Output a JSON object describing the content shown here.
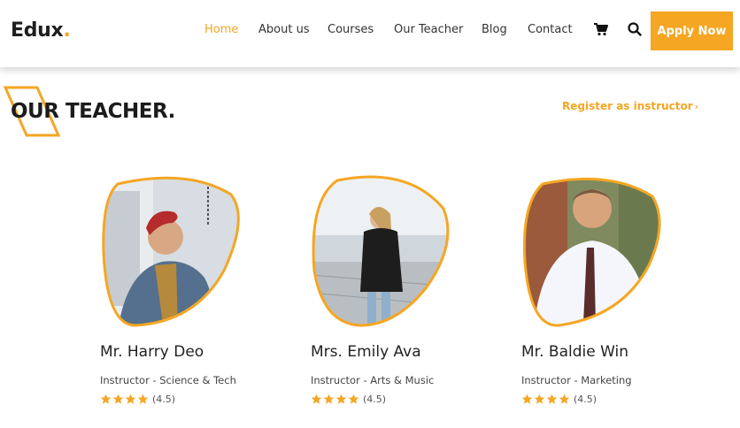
{
  "brand": {
    "name": "Edux",
    "dot": ".",
    "accent": "#f5a623"
  },
  "nav": {
    "items": [
      {
        "label": "Home",
        "active": true
      },
      {
        "label": "About us",
        "active": false
      },
      {
        "label": "Courses",
        "active": false
      },
      {
        "label": "Our Teacher",
        "active": false
      },
      {
        "label": "Blog",
        "active": false
      },
      {
        "label": "Contact",
        "active": false
      }
    ],
    "cart_icon": "cart-icon",
    "search_icon": "search-icon",
    "apply_label": "Apply Now"
  },
  "section": {
    "title": "OUR TEACHER.",
    "register_label": "Register as instructor",
    "register_chevron": "›"
  },
  "teachers": [
    {
      "name": "Mr. Harry Deo",
      "role": "Instructor - Science & Tech",
      "rating": 4.5,
      "rating_label": "(4.5)",
      "stars": 4
    },
    {
      "name": "Mrs. Emily Ava",
      "role": "Instructor - Arts & Music",
      "rating": 4.5,
      "rating_label": "(4.5)",
      "stars": 4
    },
    {
      "name": "Mr. Baldie Win",
      "role": "Instructor - Marketing",
      "rating": 4.5,
      "rating_label": "(4.5)",
      "stars": 4
    }
  ]
}
